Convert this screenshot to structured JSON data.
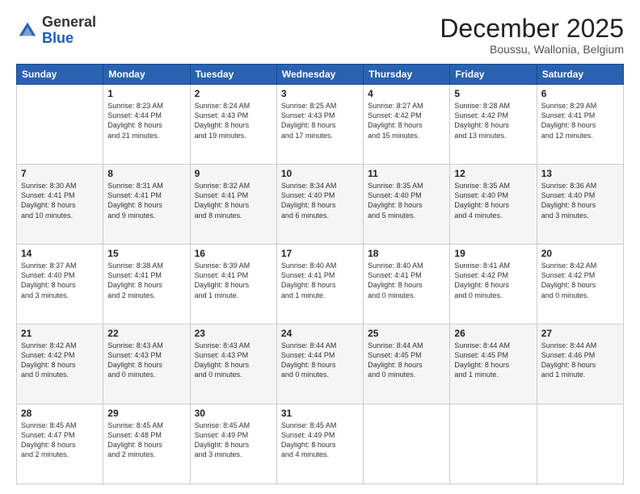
{
  "header": {
    "logo_line1": "General",
    "logo_line2": "Blue",
    "month": "December 2025",
    "location": "Boussu, Wallonia, Belgium"
  },
  "weekdays": [
    "Sunday",
    "Monday",
    "Tuesday",
    "Wednesday",
    "Thursday",
    "Friday",
    "Saturday"
  ],
  "weeks": [
    [
      {
        "day": "",
        "text": ""
      },
      {
        "day": "1",
        "text": "Sunrise: 8:23 AM\nSunset: 4:44 PM\nDaylight: 8 hours\nand 21 minutes."
      },
      {
        "day": "2",
        "text": "Sunrise: 8:24 AM\nSunset: 4:43 PM\nDaylight: 8 hours\nand 19 minutes."
      },
      {
        "day": "3",
        "text": "Sunrise: 8:25 AM\nSunset: 4:43 PM\nDaylight: 8 hours\nand 17 minutes."
      },
      {
        "day": "4",
        "text": "Sunrise: 8:27 AM\nSunset: 4:42 PM\nDaylight: 8 hours\nand 15 minutes."
      },
      {
        "day": "5",
        "text": "Sunrise: 8:28 AM\nSunset: 4:42 PM\nDaylight: 8 hours\nand 13 minutes."
      },
      {
        "day": "6",
        "text": "Sunrise: 8:29 AM\nSunset: 4:41 PM\nDaylight: 8 hours\nand 12 minutes."
      }
    ],
    [
      {
        "day": "7",
        "text": "Sunrise: 8:30 AM\nSunset: 4:41 PM\nDaylight: 8 hours\nand 10 minutes."
      },
      {
        "day": "8",
        "text": "Sunrise: 8:31 AM\nSunset: 4:41 PM\nDaylight: 8 hours\nand 9 minutes."
      },
      {
        "day": "9",
        "text": "Sunrise: 8:32 AM\nSunset: 4:41 PM\nDaylight: 8 hours\nand 8 minutes."
      },
      {
        "day": "10",
        "text": "Sunrise: 8:34 AM\nSunset: 4:40 PM\nDaylight: 8 hours\nand 6 minutes."
      },
      {
        "day": "11",
        "text": "Sunrise: 8:35 AM\nSunset: 4:40 PM\nDaylight: 8 hours\nand 5 minutes."
      },
      {
        "day": "12",
        "text": "Sunrise: 8:35 AM\nSunset: 4:40 PM\nDaylight: 8 hours\nand 4 minutes."
      },
      {
        "day": "13",
        "text": "Sunrise: 8:36 AM\nSunset: 4:40 PM\nDaylight: 8 hours\nand 3 minutes."
      }
    ],
    [
      {
        "day": "14",
        "text": "Sunrise: 8:37 AM\nSunset: 4:40 PM\nDaylight: 8 hours\nand 3 minutes."
      },
      {
        "day": "15",
        "text": "Sunrise: 8:38 AM\nSunset: 4:41 PM\nDaylight: 8 hours\nand 2 minutes."
      },
      {
        "day": "16",
        "text": "Sunrise: 8:39 AM\nSunset: 4:41 PM\nDaylight: 8 hours\nand 1 minute."
      },
      {
        "day": "17",
        "text": "Sunrise: 8:40 AM\nSunset: 4:41 PM\nDaylight: 8 hours\nand 1 minute."
      },
      {
        "day": "18",
        "text": "Sunrise: 8:40 AM\nSunset: 4:41 PM\nDaylight: 8 hours\nand 0 minutes."
      },
      {
        "day": "19",
        "text": "Sunrise: 8:41 AM\nSunset: 4:42 PM\nDaylight: 8 hours\nand 0 minutes."
      },
      {
        "day": "20",
        "text": "Sunrise: 8:42 AM\nSunset: 4:42 PM\nDaylight: 8 hours\nand 0 minutes."
      }
    ],
    [
      {
        "day": "21",
        "text": "Sunrise: 8:42 AM\nSunset: 4:42 PM\nDaylight: 8 hours\nand 0 minutes."
      },
      {
        "day": "22",
        "text": "Sunrise: 8:43 AM\nSunset: 4:43 PM\nDaylight: 8 hours\nand 0 minutes."
      },
      {
        "day": "23",
        "text": "Sunrise: 8:43 AM\nSunset: 4:43 PM\nDaylight: 8 hours\nand 0 minutes."
      },
      {
        "day": "24",
        "text": "Sunrise: 8:44 AM\nSunset: 4:44 PM\nDaylight: 8 hours\nand 0 minutes."
      },
      {
        "day": "25",
        "text": "Sunrise: 8:44 AM\nSunset: 4:45 PM\nDaylight: 8 hours\nand 0 minutes."
      },
      {
        "day": "26",
        "text": "Sunrise: 8:44 AM\nSunset: 4:45 PM\nDaylight: 8 hours\nand 1 minute."
      },
      {
        "day": "27",
        "text": "Sunrise: 8:44 AM\nSunset: 4:46 PM\nDaylight: 8 hours\nand 1 minute."
      }
    ],
    [
      {
        "day": "28",
        "text": "Sunrise: 8:45 AM\nSunset: 4:47 PM\nDaylight: 8 hours\nand 2 minutes."
      },
      {
        "day": "29",
        "text": "Sunrise: 8:45 AM\nSunset: 4:48 PM\nDaylight: 8 hours\nand 2 minutes."
      },
      {
        "day": "30",
        "text": "Sunrise: 8:45 AM\nSunset: 4:49 PM\nDaylight: 8 hours\nand 3 minutes."
      },
      {
        "day": "31",
        "text": "Sunrise: 8:45 AM\nSunset: 4:49 PM\nDaylight: 8 hours\nand 4 minutes."
      },
      {
        "day": "",
        "text": ""
      },
      {
        "day": "",
        "text": ""
      },
      {
        "day": "",
        "text": ""
      }
    ]
  ]
}
